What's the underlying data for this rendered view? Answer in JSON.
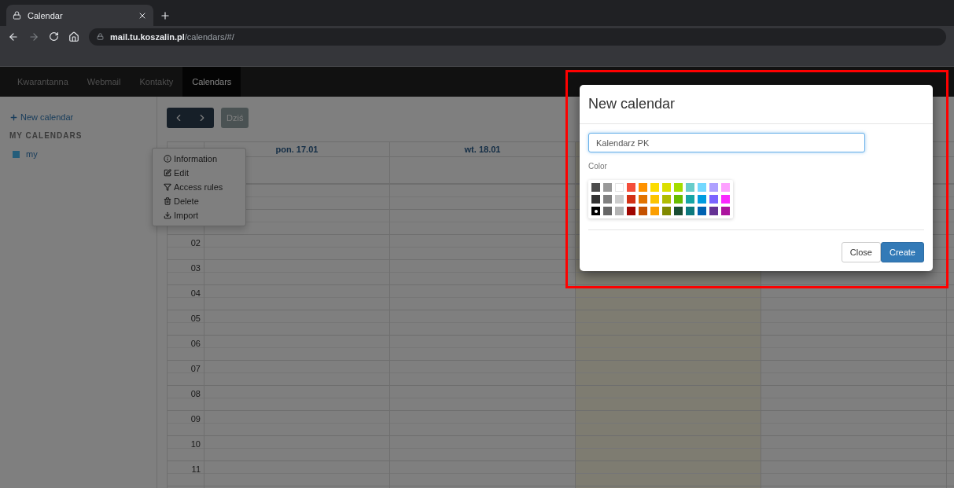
{
  "browser": {
    "tab_title": "Calendar",
    "url_host": "mail.tu.koszalin.pl",
    "url_path": "/calendars/#/"
  },
  "nav": {
    "items": [
      {
        "label": "Kwarantanna",
        "selected": false
      },
      {
        "label": "Webmail",
        "selected": false
      },
      {
        "label": "Kontakty",
        "selected": false
      },
      {
        "label": "Calendars",
        "selected": true
      }
    ]
  },
  "sidebar": {
    "new_calendar": "New calendar",
    "section": "MY CALENDARS",
    "calendars": [
      {
        "name": "my",
        "color": "#245d7a"
      }
    ]
  },
  "toolbar": {
    "today": "Dziś"
  },
  "calendar": {
    "days": [
      {
        "label": "pon. 17.01",
        "today": false
      },
      {
        "label": "wt. 18.01",
        "today": false
      },
      {
        "today": true
      },
      {
        "today": false
      },
      {
        "today": false
      }
    ],
    "hours": [
      "02",
      "03",
      "04",
      "05",
      "06",
      "07",
      "08",
      "09",
      "10",
      "11"
    ]
  },
  "context_menu": {
    "items": [
      "Information",
      "Edit",
      "Access rules",
      "Delete",
      "Import"
    ]
  },
  "dialog": {
    "title": "New calendar",
    "name_value": "Kalendarz PK",
    "color_label": "Color",
    "palette": [
      [
        {
          "color": "#4d4d4d",
          "selected": false
        },
        {
          "color": "#999999",
          "selected": false
        },
        {
          "color": "#ffffff",
          "selected": false
        },
        {
          "color": "#f44e3b",
          "selected": false
        },
        {
          "color": "#fe9200",
          "selected": false
        },
        {
          "color": "#fcdc00",
          "selected": false
        },
        {
          "color": "#dbdf00",
          "selected": false
        },
        {
          "color": "#a4dd00",
          "selected": false
        },
        {
          "color": "#68ccca",
          "selected": false
        },
        {
          "color": "#73d8ff",
          "selected": false
        },
        {
          "color": "#aea1ff",
          "selected": false
        },
        {
          "color": "#fda1ff",
          "selected": false
        }
      ],
      [
        {
          "color": "#333333",
          "selected": false
        },
        {
          "color": "#808080",
          "selected": false
        },
        {
          "color": "#cccccc",
          "selected": false
        },
        {
          "color": "#d33115",
          "selected": false
        },
        {
          "color": "#e27300",
          "selected": false
        },
        {
          "color": "#fcc400",
          "selected": false
        },
        {
          "color": "#b0bc00",
          "selected": false
        },
        {
          "color": "#68bc00",
          "selected": false
        },
        {
          "color": "#16a5a5",
          "selected": false
        },
        {
          "color": "#009ce0",
          "selected": false
        },
        {
          "color": "#7b64ff",
          "selected": false
        },
        {
          "color": "#fa28ff",
          "selected": false
        }
      ],
      [
        {
          "color": "#000000",
          "selected": true
        },
        {
          "color": "#666666",
          "selected": false
        },
        {
          "color": "#b3b3b3",
          "selected": false
        },
        {
          "color": "#9f0500",
          "selected": false
        },
        {
          "color": "#c45100",
          "selected": false
        },
        {
          "color": "#fb9e00",
          "selected": false
        },
        {
          "color": "#808900",
          "selected": false
        },
        {
          "color": "#194d33",
          "selected": false
        },
        {
          "color": "#0c797d",
          "selected": false
        },
        {
          "color": "#0062b1",
          "selected": false
        },
        {
          "color": "#653294",
          "selected": false
        },
        {
          "color": "#ab149e",
          "selected": false
        }
      ]
    ],
    "close": "Close",
    "create": "Create"
  }
}
